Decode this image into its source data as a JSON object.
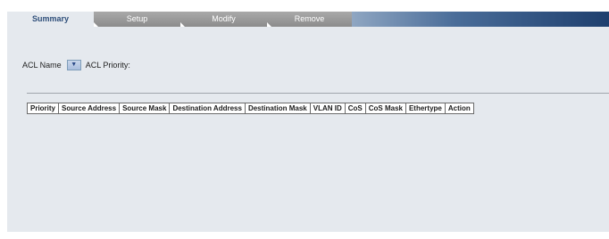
{
  "tabs": [
    {
      "label": "Summary",
      "active": true
    },
    {
      "label": "Setup",
      "active": false
    },
    {
      "label": "Modify",
      "active": false
    },
    {
      "label": "Remove",
      "active": false
    }
  ],
  "acl": {
    "name_label": "ACL Name",
    "select_value": "",
    "priority_label": "ACL Priority:"
  },
  "table": {
    "columns": [
      "Priority",
      "Source Address",
      "Source Mask",
      "Destination Address",
      "Destination Mask",
      "VLAN ID",
      "CoS",
      "CoS Mask",
      "Ethertype",
      "Action"
    ],
    "rows": []
  },
  "colors": {
    "panel": "#e5e9ee",
    "tab_inactive": "#8c8c8c",
    "tab_active_text": "#2f4f7a",
    "tabbar_gradient_end": "#1e3f6e"
  }
}
